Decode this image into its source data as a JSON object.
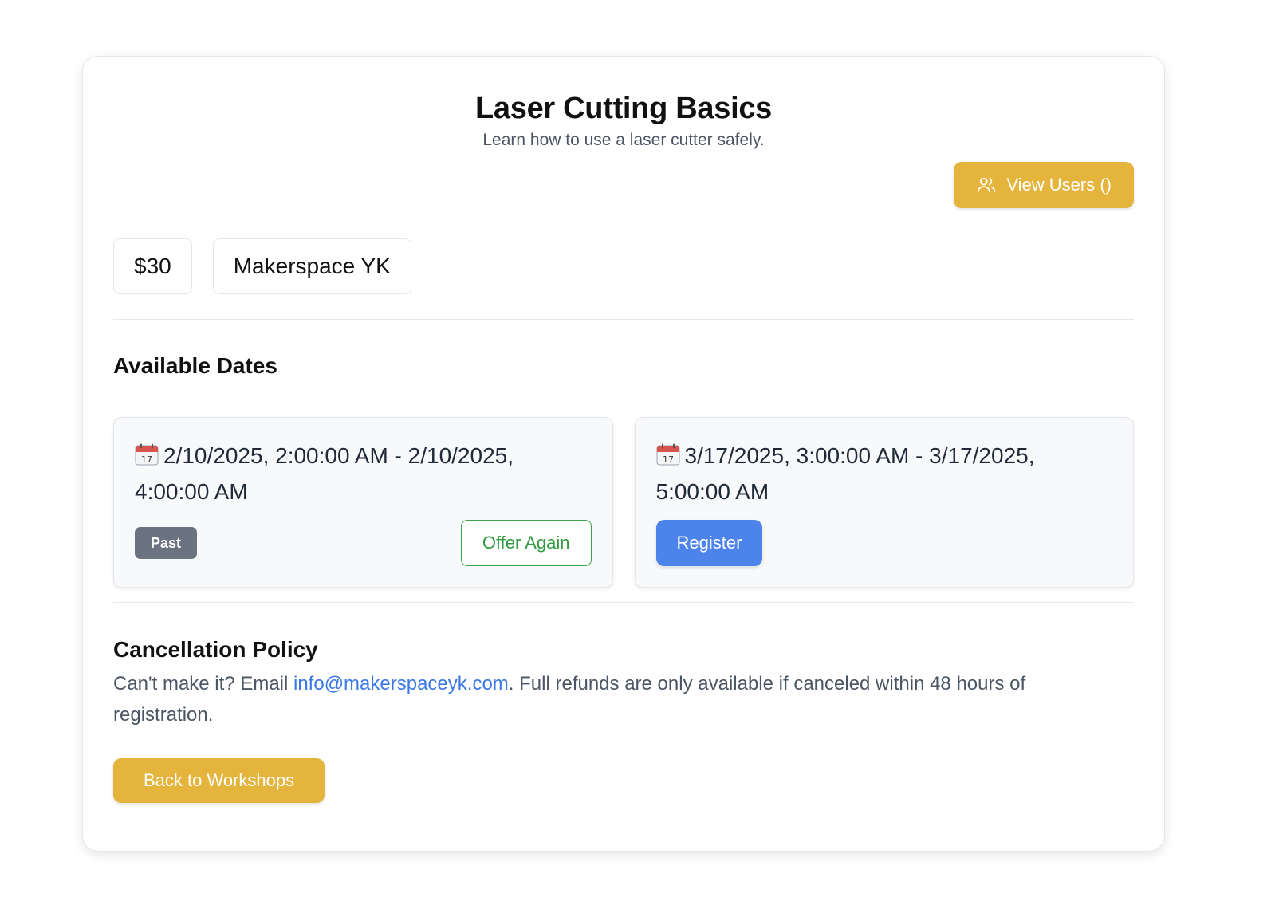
{
  "workshop": {
    "title": "Laser Cutting Basics",
    "description": "Learn how to use a laser cutter safely."
  },
  "view_users_button": {
    "label": "View Users ()",
    "icon": "users-icon"
  },
  "details": {
    "price": "$30",
    "location": "Makerspace YK"
  },
  "available_dates": {
    "heading": "Available Dates",
    "items": [
      {
        "icon": "calendar-icon",
        "range": "2/10/2025, 2:00:00 AM - 2/10/2025, 4:00:00 AM",
        "status_badge": "Past",
        "action_label": "Offer Again"
      },
      {
        "icon": "calendar-icon",
        "range": "3/17/2025, 3:00:00 AM - 3/17/2025, 5:00:00 AM",
        "action_label": "Register"
      }
    ]
  },
  "cancellation_policy": {
    "heading": "Cancellation Policy",
    "text_before": "Can't make it? Email ",
    "email": "info@makerspaceyk.com",
    "text_after": ". Full refunds are only available if canceled within 48 hours of registration."
  },
  "back_button": {
    "label": "Back to Workshops"
  },
  "colors": {
    "accent_yellow": "#e4b43c",
    "register_blue": "#4d84ec",
    "offer_green": "#2f9a3e",
    "past_badge_gray": "#6b7280",
    "link_blue": "#3b78e7"
  }
}
